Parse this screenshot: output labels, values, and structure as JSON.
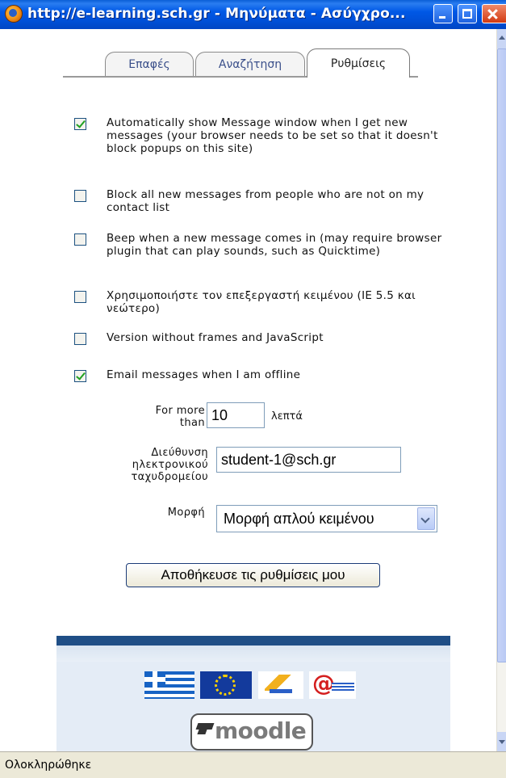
{
  "window": {
    "title": "http://e-learning.sch.gr - Μηνύματα - Ασύγχρο..."
  },
  "tabs": [
    {
      "label": "Επαφές"
    },
    {
      "label": "Αναζήτηση"
    },
    {
      "label": "Ρυθμίσεις",
      "active": true
    }
  ],
  "options": [
    {
      "label": "Automatically show Message window when I get new messages (your browser needs to be set so that it doesn't block popups on this site)",
      "checked": true
    },
    {
      "label": "Block all new messages from people who are not on my contact list",
      "checked": false
    },
    {
      "label": "Beep when a new message comes in (may require browser plugin that can play sounds, such as Quicktime)",
      "checked": false
    },
    {
      "label": "Χρησιμοποιήστε τον επεξεργαστή κειμένου (IE 5.5 και νεώτερο)",
      "checked": false
    },
    {
      "label": "Version without frames and JavaScript",
      "checked": false
    },
    {
      "label": "Email messages when I am offline",
      "checked": true
    }
  ],
  "email": {
    "more_than_label": "For more than",
    "minutes_value": "10",
    "minutes_unit": "λεπτά",
    "address_label": "Διεύθυνση ηλεκτρονικού ταχυδρομείου",
    "address_value": "student-1@sch.gr",
    "format_label": "Μορφή",
    "format_value": "Μορφή απλού κειμένου"
  },
  "save_button": "Αποθήκευσε τις ρυθμίσεις μου",
  "footer": {
    "moodle_label": "moodle"
  },
  "status": "Ολοκληρώθηκε",
  "colors": {
    "titlebar": "#0058e6",
    "checkbox_check": "#21a121",
    "footer_band": "#1f4e86"
  }
}
